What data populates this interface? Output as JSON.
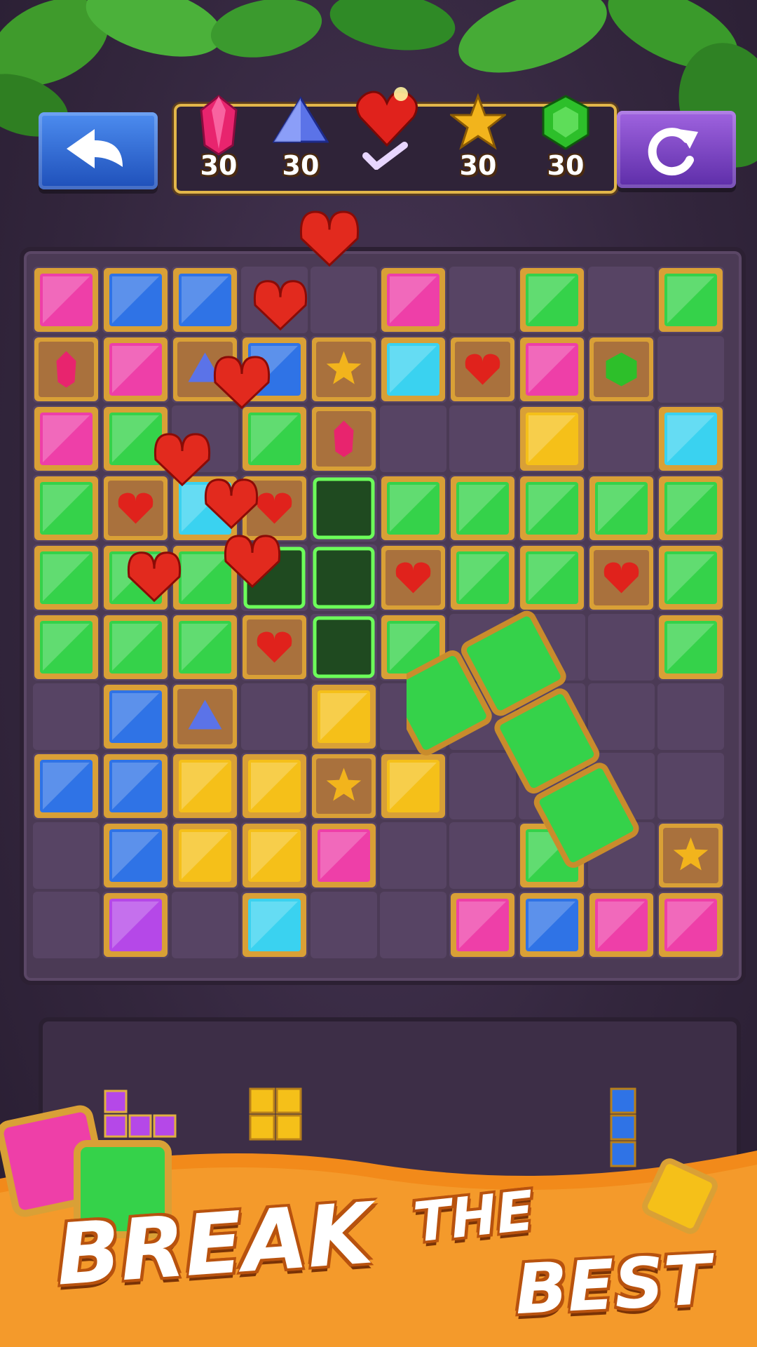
{
  "game": {
    "goals": [
      {
        "icon": "pink-crystal-icon",
        "count": "30",
        "color": "#e8246e"
      },
      {
        "icon": "blue-triangle-gem-icon",
        "count": "30",
        "color": "#5b73e8"
      },
      {
        "icon": "red-heart-gem-icon",
        "count": "",
        "color": "#e0221c",
        "completed": true
      },
      {
        "icon": "gold-star-icon",
        "count": "30",
        "color": "#f2b41c"
      },
      {
        "icon": "green-emerald-icon",
        "count": "30",
        "color": "#2dbf2a"
      }
    ],
    "buttons": {
      "back": "back-arrow-icon",
      "restart": "restart-icon"
    },
    "palette": {
      "pink": "#ee3fa8",
      "blue": "#2f73e6",
      "cyan": "#3ad2f0",
      "green": "#35d24a",
      "yellow": "#f5c019",
      "purple": "#b548e8",
      "wood": "#a9713d",
      "empty": "#574464"
    },
    "board_rows": [
      "P B B . . P . G . G",
      "Wp P Wt B Ws C Wh P We .",
      "P G . G Wp . . Y . C",
      "G Wh C Wh x G G G G G",
      "G G G x x Wh G G Wh G",
      "G G G Wh x G . . . G",
      ". B Wt . Y . . . . .",
      "B B Y Y Ws Y . . . .",
      ". B Y Y P . . G . Ws",
      ". Pu . C . . P B P P"
    ],
    "tray_pieces": [
      "purple-l-piece",
      "yellow-square-piece",
      "blue-i-piece"
    ]
  },
  "slogan": {
    "line1": "BREAK",
    "line2": "THE",
    "line3": "BEST"
  }
}
